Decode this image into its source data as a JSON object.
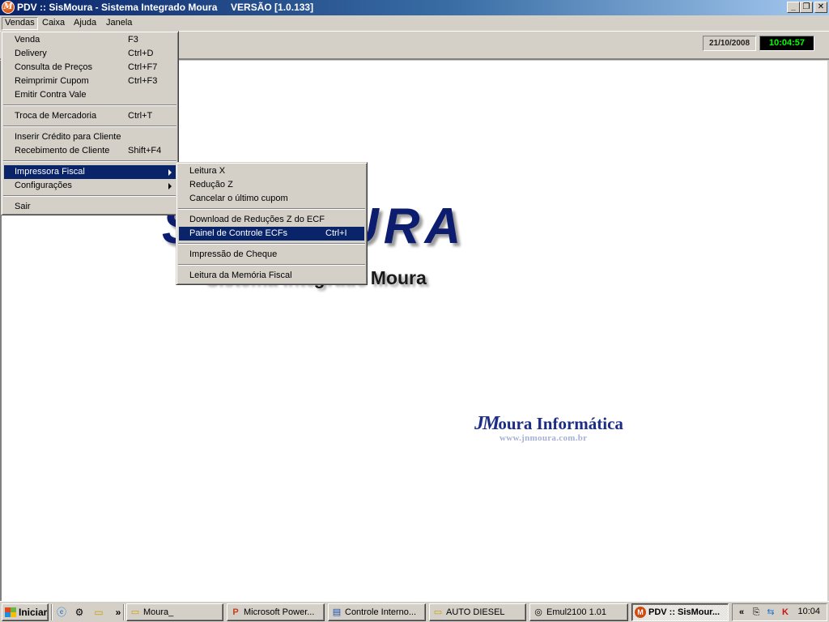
{
  "window": {
    "title": "PDV :: SisMoura - Sistema Integrado Moura     VERSÃO [1.0.133]",
    "app_icon": "M",
    "buttons": {
      "minimize": "_",
      "restore": "❐",
      "close": "✕"
    }
  },
  "menubar": {
    "items": [
      "Vendas",
      "Caixa",
      "Ajuda",
      "Janela"
    ],
    "open_menu": "Vendas"
  },
  "status": {
    "date": "21/10/2008",
    "clock": "10:04:57"
  },
  "background": {
    "logo_big": "SisMOURA",
    "logo_subtitle": "Sistema Integrado Moura",
    "company_logo_jm": "JM",
    "company_logo_text": "oura Informática",
    "company_url": "www.jnmoura.com.br"
  },
  "vendas_menu": {
    "items": [
      {
        "label": "Venda",
        "shortcut": "F3"
      },
      {
        "label": "Delivery",
        "shortcut": "Ctrl+D"
      },
      {
        "label": "Consulta de Preços",
        "shortcut": "Ctrl+F7"
      },
      {
        "label": "Reimprimir Cupom",
        "shortcut": "Ctrl+F3"
      },
      {
        "label": "Emitir Contra Vale",
        "shortcut": ""
      },
      {
        "label": "Troca de Mercadoria",
        "shortcut": "Ctrl+T"
      },
      {
        "label": "Inserir Crédito para Cliente",
        "shortcut": ""
      },
      {
        "label": "Recebimento de Cliente",
        "shortcut": "Shift+F4"
      },
      {
        "label": "Impressora Fiscal",
        "shortcut": ""
      },
      {
        "label": "Configurações",
        "shortcut": ""
      },
      {
        "label": "Sair",
        "shortcut": ""
      }
    ],
    "highlighted": "Impressora Fiscal"
  },
  "impressora_submenu": {
    "items": [
      {
        "label": "Leitura X",
        "shortcut": ""
      },
      {
        "label": "Redução Z",
        "shortcut": ""
      },
      {
        "label": "Cancelar o último cupom",
        "shortcut": ""
      },
      {
        "label": "Download de Reduções Z do ECF",
        "shortcut": ""
      },
      {
        "label": "Painel de Controle ECFs",
        "shortcut": "Ctrl+I"
      },
      {
        "label": "Impressão de Cheque",
        "shortcut": ""
      },
      {
        "label": "Leitura da Memória Fiscal",
        "shortcut": ""
      }
    ],
    "highlighted": "Painel de Controle ECFs"
  },
  "taskbar": {
    "start_label": "Iniciar",
    "chevron": "»",
    "tasks": [
      {
        "label": "Moura_",
        "icon": "folder-icon"
      },
      {
        "label": "Microsoft Power...",
        "icon": "powerpoint-icon"
      },
      {
        "label": "Controle Interno...",
        "icon": "document-icon"
      },
      {
        "label": "AUTO DIESEL",
        "icon": "folder-icon"
      },
      {
        "label": "Emul2100 1.01",
        "icon": "emulator-icon"
      },
      {
        "label": "PDV :: SisMour...",
        "icon": "app-m-icon"
      }
    ],
    "active_task": "PDV :: SisMour...",
    "tray": {
      "expand": "«",
      "time": "10:04"
    }
  },
  "colors": {
    "menu_highlight": "#0a246a",
    "clock_fg": "#00ff00",
    "logo_blue": "#0c1c6e"
  }
}
